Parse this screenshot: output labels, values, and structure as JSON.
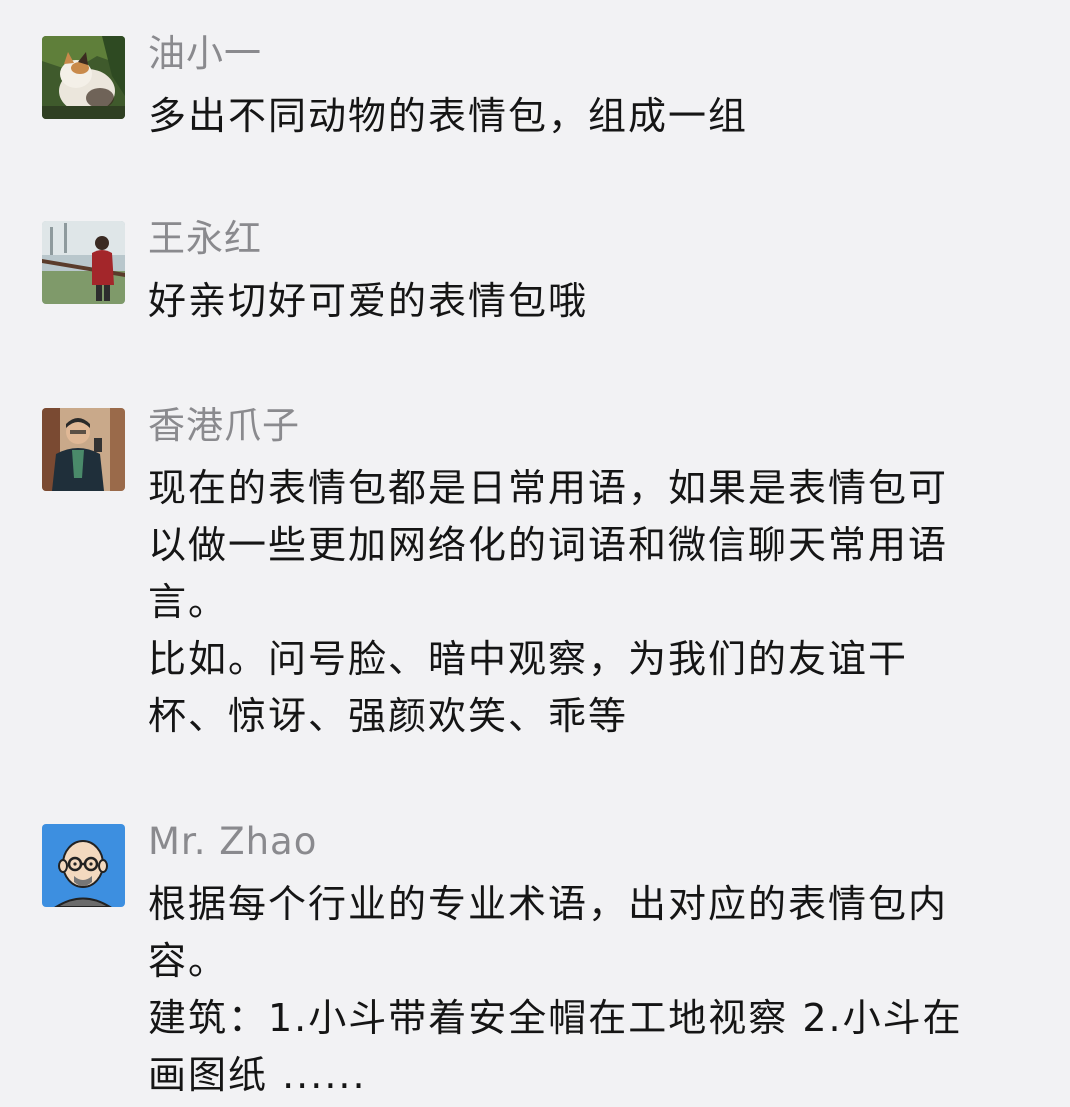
{
  "comments": [
    {
      "author": "油小一",
      "avatar_icon": "cat-photo-avatar",
      "lines": [
        "多出不同动物的表情包，组成一组"
      ]
    },
    {
      "author": "王永红",
      "avatar_icon": "woman-outdoor-photo-avatar",
      "lines": [
        "好亲切好可爱的表情包哦"
      ]
    },
    {
      "author": "香港爪子",
      "avatar_icon": "man-mirror-selfie-avatar",
      "lines": [
        "现在的表情包都是日常用语，如果是表情包可",
        "以做一些更加网络化的词语和微信聊天常用语",
        "言。",
        "比如。问号脸、暗中观察，为我们的友谊干",
        "杯、惊讶、强颜欢笑、乖等"
      ]
    },
    {
      "author": "Mr. Zhao",
      "avatar_icon": "cartoon-bald-man-avatar",
      "lines": [
        "根据每个行业的专业术语，出对应的表情包内",
        "容。",
        "建筑：1.小斗带着安全帽在工地视察 2.小斗在",
        "画图纸 ......"
      ]
    }
  ],
  "colors": {
    "background": "#f2f2f4",
    "author_name": "#8a8a8e",
    "comment_text": "#151515",
    "zhao_avatar_bg": "#3d8fe0"
  }
}
